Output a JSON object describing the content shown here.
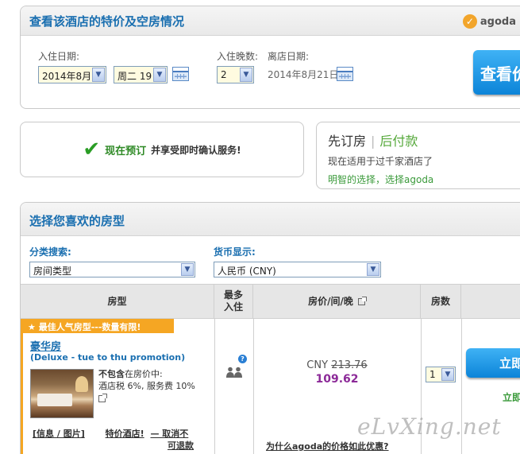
{
  "search": {
    "title": "查看该酒店的特价及空房情况",
    "brand": "agoda",
    "checkin_label": "入住日期:",
    "month_value": "2014年8月",
    "day_value": "周二 19",
    "nights_label": "入住晚数:",
    "nights_value": "2",
    "checkout_label": "离店日期:",
    "checkout_value": "2014年8月21日",
    "search_button": "查看价"
  },
  "book_now": {
    "main": "现在预订",
    "sub": "并享受即时确认服务!"
  },
  "pay_later": {
    "head_left": "先订房",
    "head_right": "后付款",
    "line1": "现在适用于过千家酒店了",
    "line2": "明智的选择，选择agoda"
  },
  "rooms": {
    "title": "选择您喜欢的房型",
    "filter_label": "分类搜索:",
    "filter_value": "房间类型",
    "currency_label": "货币显示:",
    "currency_value": "人民币 (CNY)",
    "columns": {
      "room": "房型",
      "max_line1": "最多",
      "max_line2": "入住",
      "price": "房价/间/晚",
      "qty": "房数"
    },
    "items": [
      {
        "banner": "最佳人气房型---数量有限!",
        "name": "豪华房",
        "name_en": "(Deluxe - tue to thu promotion)",
        "tax_line1_bold": "不包含",
        "tax_line1_rest": "在房价中:",
        "tax_line2": "酒店税 6%, 服务费 10%",
        "link_info": "[信息 / 图片]",
        "link_special": "特价酒店!",
        "cancel_line1": "— 取消不",
        "cancel_line2": "可退款",
        "currency": "CNY",
        "original_price": "213.76",
        "sale_price": "109.62",
        "why_cheap": "为什么agoda的价格如此优惠?",
        "qty_value": "1",
        "book_button": "立即",
        "book_green": "立即"
      }
    ]
  },
  "watermark": "eLvXing.net",
  "colors": {
    "title_blue": "#1a6fb0",
    "banner_orange": "#f5a623",
    "sale_purple": "#8c2a98",
    "button_blue": "#0c84d8",
    "green": "#3a9a3a"
  }
}
